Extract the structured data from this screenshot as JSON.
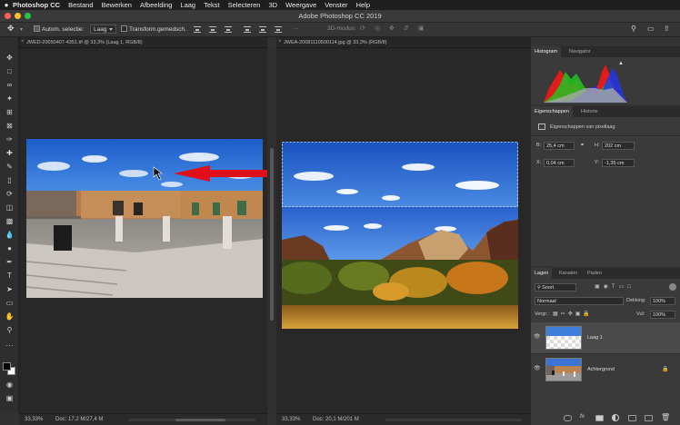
{
  "menubar": {
    "apple": "",
    "items": [
      "Photoshop CC",
      "Bestand",
      "Bewerken",
      "Afbeelding",
      "Laag",
      "Tekst",
      "Selecteren",
      "3D",
      "Weergave",
      "Venster",
      "Help"
    ]
  },
  "window": {
    "title": "Adobe Photoshop CC 2019"
  },
  "options": {
    "auto_select_label": "Autom. selectie:",
    "auto_select_value": "Laag",
    "transform_label": "Transform.gemedsch.",
    "mode_3d_label": "3D-modus:"
  },
  "documents": [
    {
      "tab": "JWED-20050407-4351.tif @ 33,3% (Laag 1, RGB/8)",
      "zoom": "33,33%",
      "doc_info": "Doc: 17,2 M/27,4 M"
    },
    {
      "tab": "JWEA-20081110500114.jpg @ 33,3% (RGB/8)",
      "zoom": "33,33%",
      "doc_info": "Doc: 20,1 M/201 M"
    }
  ],
  "panels": {
    "histogram_tabs": [
      "Histogram",
      "Navigator"
    ],
    "properties_tabs": [
      "Eigenschappen",
      "Historie"
    ],
    "properties_title": "Eigenschappen van pixellaag",
    "W_label": "B:",
    "W_value": "25,4 cm",
    "H_label": "H:",
    "H_value": "202 cm",
    "X_label": "X:",
    "X_value": "0,04 cm",
    "Y_label": "Y:",
    "Y_value": "-1,35 cm",
    "layers_tabs": [
      "Lagen",
      "Kanalen",
      "Paden"
    ],
    "kind_filter": "Soort",
    "blend_mode": "Normaal",
    "opacity_label": "Dekking:",
    "opacity_value": "100%",
    "lock_label": "Vergr.:",
    "fill_label": "Vul:",
    "fill_value": "100%",
    "layers": [
      {
        "name": "Laag 1",
        "selected": true
      },
      {
        "name": "Achtergrond",
        "selected": false
      }
    ]
  },
  "colors": {
    "accent_arrow": "#e0101a",
    "panel_bg": "#333333",
    "selected_layer": "#4a4a4a"
  }
}
